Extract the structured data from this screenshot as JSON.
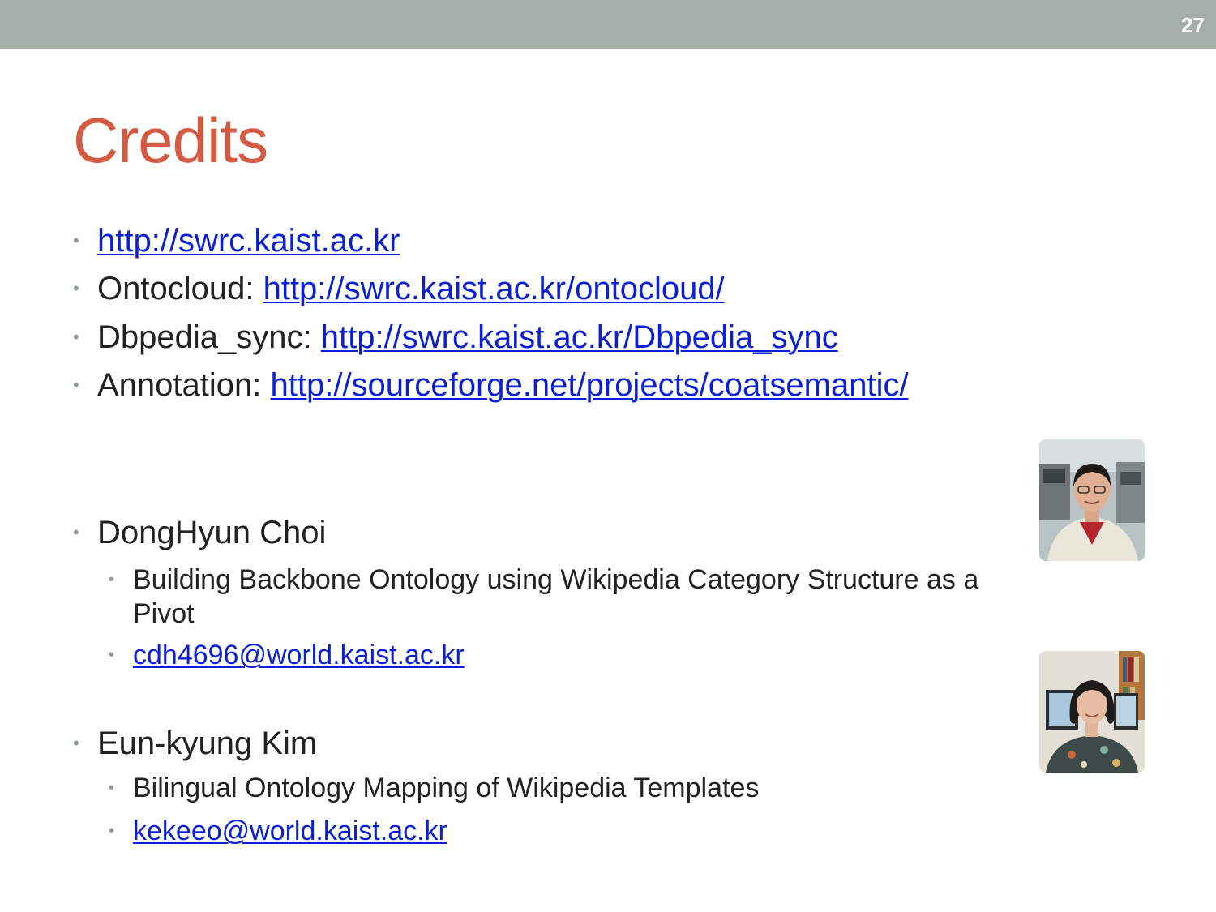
{
  "slide_number": "27",
  "title": "Credits",
  "links": [
    {
      "label": "",
      "url": "http://swrc.kaist.ac.kr"
    },
    {
      "label": "Ontocloud: ",
      "url": "http://swrc.kaist.ac.kr/ontocloud/"
    },
    {
      "label": "Dbpedia_sync: ",
      "url": "http://swrc.kaist.ac.kr/Dbpedia_sync"
    },
    {
      "label": "Annotation: ",
      "url": "http://sourceforge.net/projects/coatsemantic/"
    }
  ],
  "people": [
    {
      "name": "DongHyun Choi",
      "topic_line1": "Building Backbone Ontology using Wikipedia Category Structure as a",
      "topic_line2": "Pivot",
      "email": "cdh4696@world.kaist.ac.kr",
      "photo_icon": "portrait-photo"
    },
    {
      "name": "Eun-kyung Kim",
      "topic_line1": "Bilingual Ontology Mapping of Wikipedia Templates",
      "email": "kekeeo@world.kaist.ac.kr",
      "photo_icon": "portrait-photo"
    }
  ],
  "colors": {
    "top_bar": "#a5afa8",
    "title": "#d35a43",
    "link": "#0a1fd6",
    "bullet": "#8f9a93"
  },
  "bullet_glyph": "•"
}
